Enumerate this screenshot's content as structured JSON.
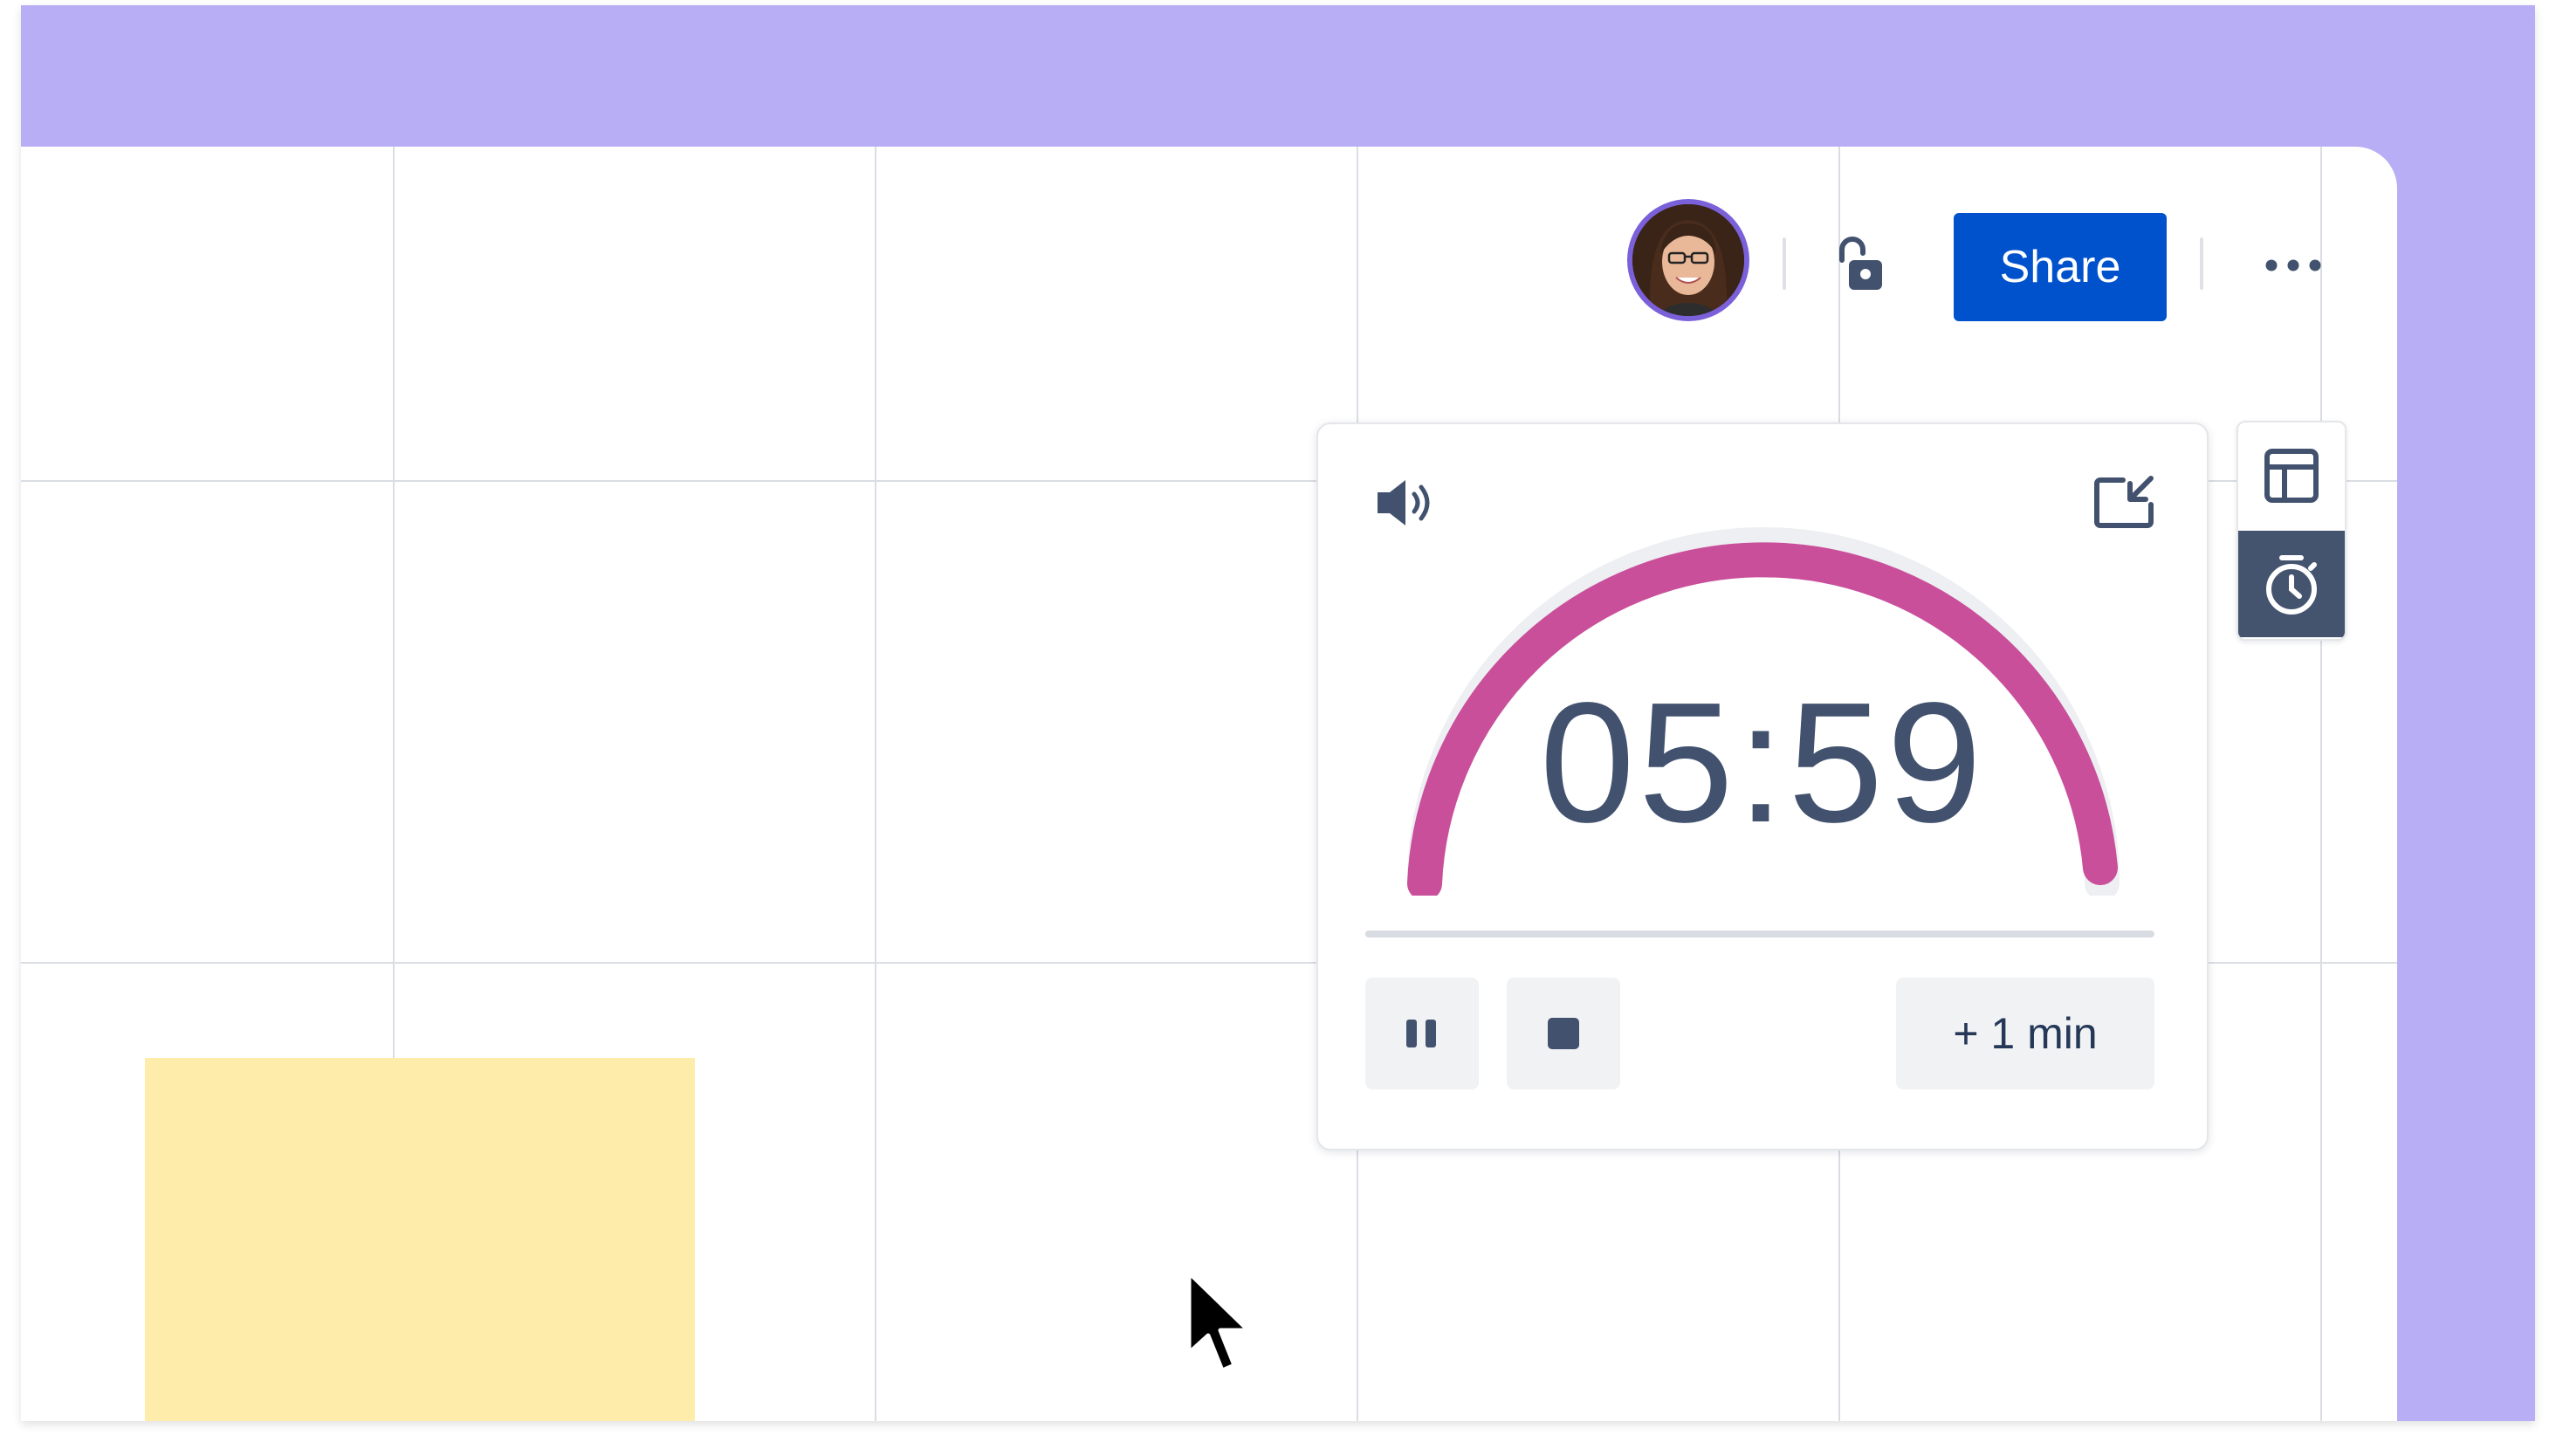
{
  "toolbar": {
    "avatar_name": "avatar",
    "share_label": "Share",
    "lock_icon": "unlock-icon",
    "more_icon": "more-icon"
  },
  "timer": {
    "time": "05:59",
    "add_label": "+ 1 min",
    "sound_icon": "speaker-icon",
    "minimize_icon": "minimize-icon",
    "pause_icon": "pause-icon",
    "stop_icon": "stop-icon",
    "arc_color": "#c94f9b",
    "time_color": "#42526e",
    "progress": 1.0
  },
  "side_toolbar": {
    "items": [
      {
        "icon": "template-icon",
        "active": false
      },
      {
        "icon": "stopwatch-icon",
        "active": true
      }
    ]
  },
  "colors": {
    "frame_bg": "#b8aef5",
    "share_bg": "#0052cc",
    "sticky_note": "#fdecaa",
    "avatar_ring": "#7b61d9"
  }
}
